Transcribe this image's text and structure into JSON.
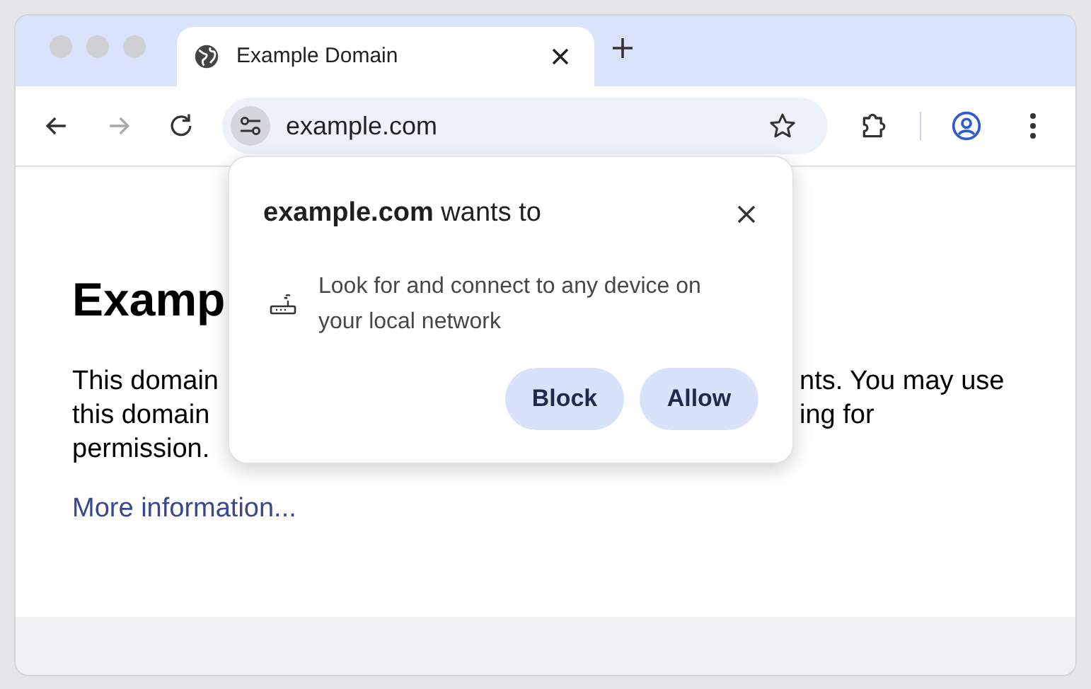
{
  "tabs": [
    {
      "title": "Example Domain",
      "selected": true
    }
  ],
  "nav_buttons": [
    {
      "kind": "back",
      "disabled": false
    },
    {
      "kind": "forward",
      "disabled": true
    },
    {
      "kind": "reload",
      "disabled": false
    }
  ],
  "address_bar": {
    "value": "example.com"
  },
  "page": {
    "heading": "Examp",
    "left_lines": [
      "This domain",
      "this domain",
      "permission."
    ],
    "right_lines": [
      "nts. You may use",
      "ing for"
    ],
    "link": "More information..."
  },
  "permission_popup": {
    "title": "**example.com** wants to",
    "description": "Look for and connect to any device on your local network",
    "buttons": [
      "Block",
      "Allow"
    ]
  }
}
